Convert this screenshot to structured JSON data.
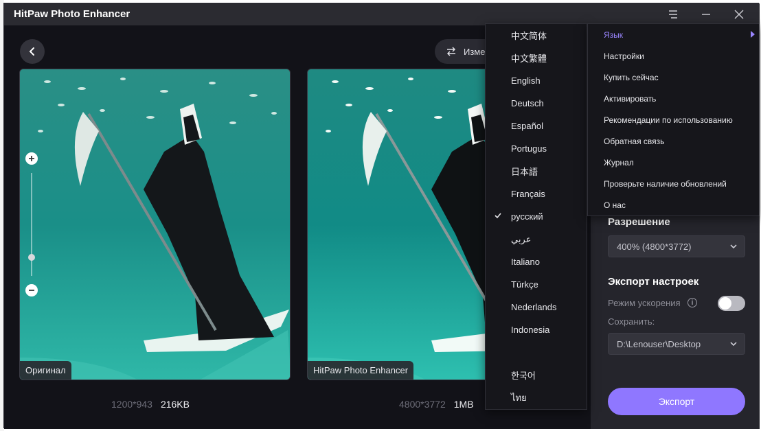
{
  "window": {
    "title": "HitPaw Photo Enhancer"
  },
  "toolbar": {
    "compare_label": "Изме"
  },
  "preview": {
    "left_label": "Оригинал",
    "right_label": "HitPaw Photo Enhancer",
    "left_dimensions": "1200*943",
    "left_size": "216KB",
    "right_dimensions": "4800*3772",
    "right_size": "1MB",
    "zoom_level_fraction": 0.18
  },
  "settings": {
    "resolution_heading": "Разрешение",
    "resolution_value": "400% (4800*3772)",
    "export_heading": "Экспорт настроек",
    "acceleration_label": "Режим ускорения",
    "acceleration_enabled": false,
    "save_label": "Сохранить:",
    "save_path": "D:\\Lenouser\\Desktop",
    "export_button": "Экспорт"
  },
  "main_menu": {
    "items": [
      {
        "label": "Язык",
        "active": true
      },
      {
        "label": "Настройки"
      },
      {
        "label": "Купить сейчас"
      },
      {
        "label": "Активировать"
      },
      {
        "label": "Рекомендации по использованию"
      },
      {
        "label": "Обратная связь"
      },
      {
        "label": "Журнал"
      },
      {
        "label": "Проверьте наличие обновлений"
      },
      {
        "label": "О нас"
      }
    ]
  },
  "language_menu": {
    "items": [
      {
        "label": "中文简体"
      },
      {
        "label": "中文繁體"
      },
      {
        "label": "English"
      },
      {
        "label": "Deutsch"
      },
      {
        "label": "Español"
      },
      {
        "label": "Portugus"
      },
      {
        "label": "日本語"
      },
      {
        "label": "Français"
      },
      {
        "label": "русский",
        "selected": true
      },
      {
        "label": "عربي"
      },
      {
        "label": "Italiano"
      },
      {
        "label": "Türkçe"
      },
      {
        "label": "Nederlands"
      },
      {
        "label": "Indonesia"
      },
      {
        "label": "한국어"
      },
      {
        "label": "ไทย"
      }
    ]
  },
  "colors": {
    "accent": "#8f77ff",
    "menu_active": "#9a86ff",
    "window_bg": "#121218",
    "panel_bg": "#25252c",
    "photo_water": "#1f8f86"
  },
  "icons": {
    "back": "chevron-left-icon",
    "compare": "swap-arrows-icon",
    "zoom_in": "plus-icon",
    "zoom_out": "minus-icon",
    "info": "info-icon",
    "dropdown": "chevron-down-icon",
    "check": "check-icon",
    "submenu": "triangle-right-icon",
    "menu": "hamburger-icon",
    "minimize": "minimize-icon",
    "close": "close-icon"
  }
}
